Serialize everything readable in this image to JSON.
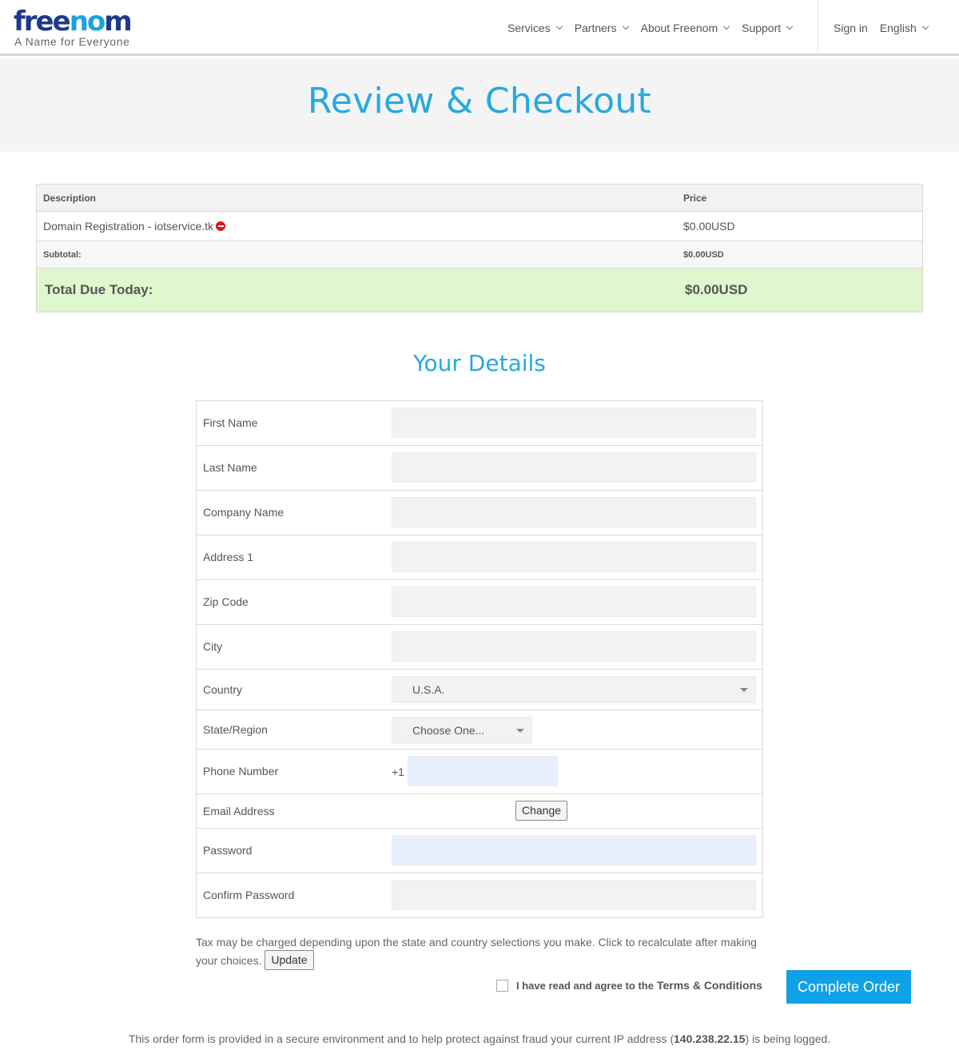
{
  "header": {
    "logo_part1": "free",
    "logo_part2": "no",
    "logo_part3": "m",
    "tagline": "A Name for Everyone",
    "nav": [
      "Services",
      "Partners",
      "About Freenom",
      "Support"
    ],
    "signin": "Sign in",
    "language": "English"
  },
  "hero": {
    "title": "Review & Checkout"
  },
  "cart": {
    "col_description": "Description",
    "col_price": "Price",
    "item_description": "Domain Registration - iotservice.tk",
    "item_price": "$0.00USD",
    "subtotal_label": "Subtotal:",
    "subtotal_value": "$0.00USD",
    "total_label": "Total Due Today:",
    "total_value": "$0.00USD"
  },
  "details": {
    "title": "Your Details",
    "first_name": "First Name",
    "last_name": "Last Name",
    "company_name": "Company Name",
    "address1": "Address 1",
    "zip": "Zip Code",
    "city": "City",
    "country": "Country",
    "country_value": "U.S.A.",
    "state": "State/Region",
    "state_value": "Choose One...",
    "phone": "Phone Number",
    "phone_prefix": "+1",
    "email": "Email Address",
    "email_change": "Change",
    "password": "Password",
    "confirm_password": "Confirm Password"
  },
  "footer": {
    "tax_note": "Tax may be charged depending upon the state and country selections you make. Click to recalculate after making your choices.",
    "update_button": "Update",
    "terms_prefix": "I have read and agree to the",
    "terms_link": "Terms & Conditions",
    "complete_button": "Complete Order",
    "secure_note_pre": "This order form is provided in a secure environment and to help protect against fraud your current IP address (",
    "ip_address": "140.238.22.15",
    "secure_note_post": ") is being logged."
  }
}
